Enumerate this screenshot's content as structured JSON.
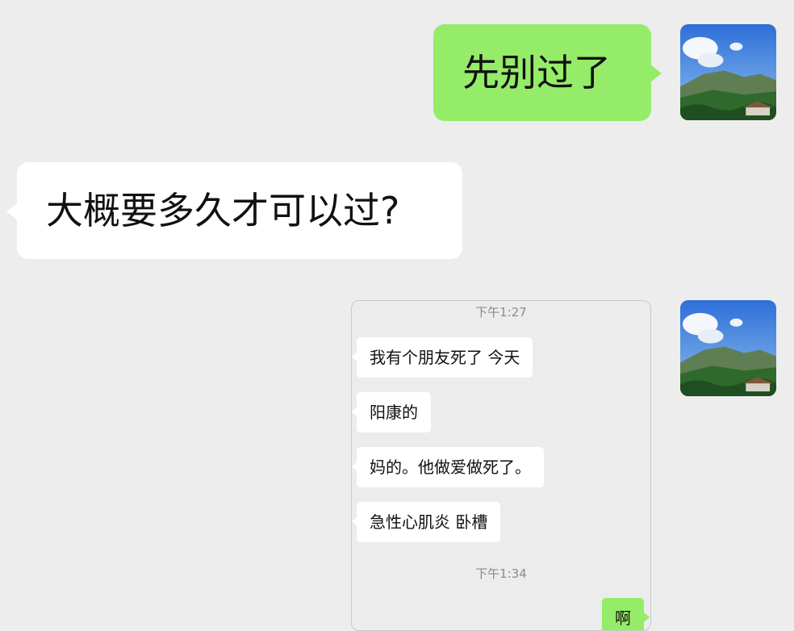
{
  "messages": [
    {
      "side": "right",
      "text": "先别过了"
    },
    {
      "side": "left",
      "text": "大概要多久才可以过?"
    }
  ],
  "screenshot": {
    "timestamp1": "下午1:27",
    "bubbles": [
      "我有个朋友死了 今天",
      "阳康的",
      "妈的。他做爱做死了。",
      "急性心肌炎 卧槽"
    ],
    "timestamp2": "下午1:34",
    "reply": "啊"
  },
  "colors": {
    "background": "#ededed",
    "green_bubble": "#95ec69",
    "white_bubble": "#ffffff"
  }
}
